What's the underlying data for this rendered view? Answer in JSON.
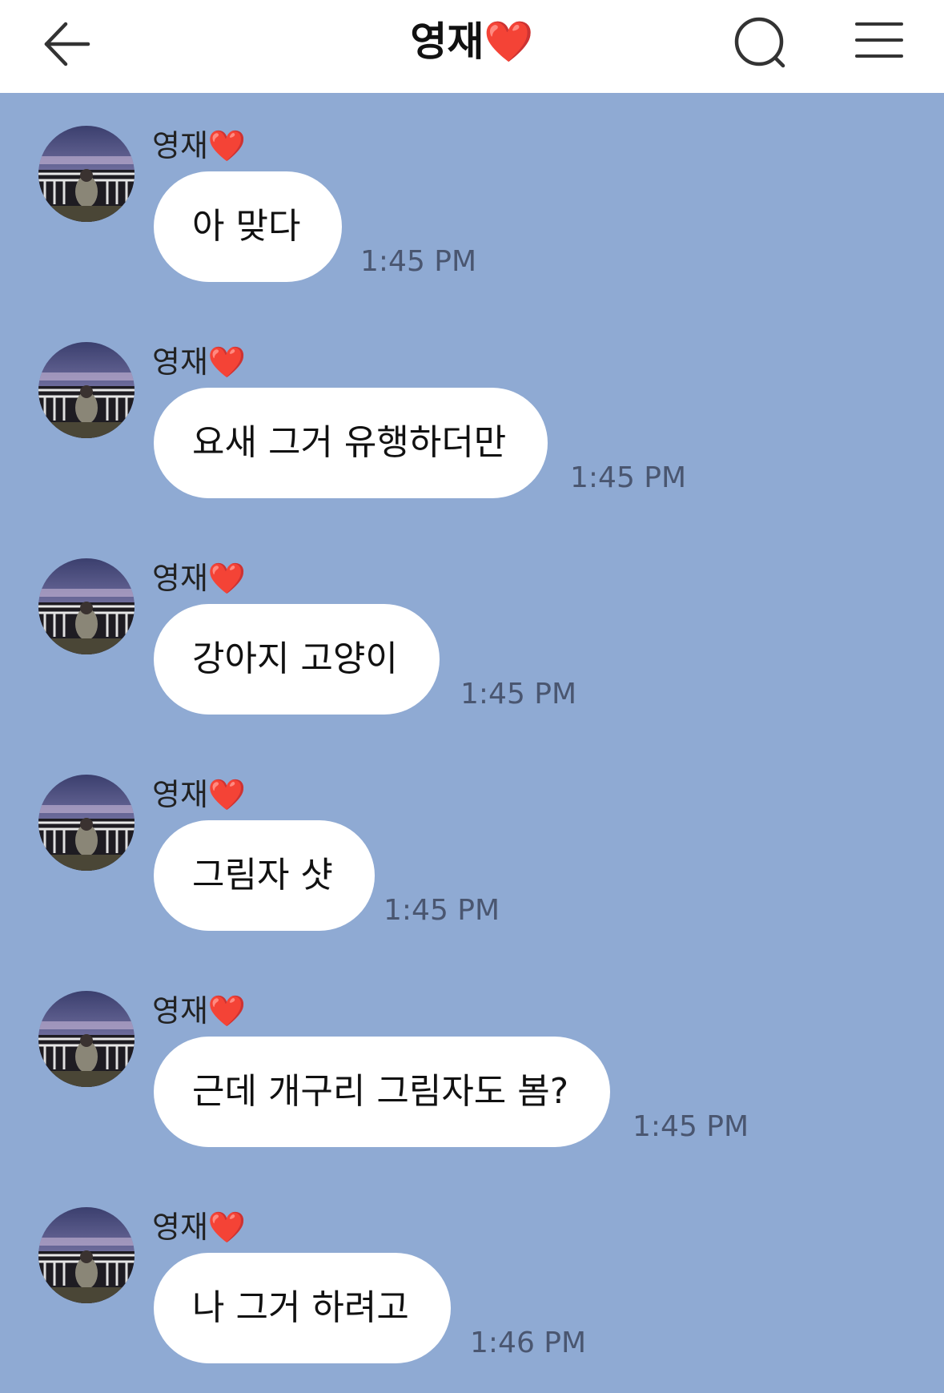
{
  "header": {
    "title": "영재❤️",
    "back_icon": "arrow-left-icon",
    "search_icon": "search-icon",
    "menu_icon": "hamburger-menu-icon"
  },
  "colors": {
    "header_bg": "#ffffff",
    "chat_bg": "#8faad3",
    "bubble_bg": "#ffffff",
    "time_text": "#4a5670"
  },
  "messages": [
    {
      "sender": "영재❤️",
      "text": "아 맞다",
      "time": "1:45 PM"
    },
    {
      "sender": "영재❤️",
      "text": "요새 그거 유행하더만",
      "time": "1:45 PM"
    },
    {
      "sender": "영재❤️",
      "text": "강아지 고양이",
      "time": "1:45 PM"
    },
    {
      "sender": "영재❤️",
      "text": "그림자 샷",
      "time": "1:45 PM"
    },
    {
      "sender": "영재❤️",
      "text": "근데 개구리 그림자도 봄?",
      "time": "1:45 PM"
    },
    {
      "sender": "영재❤️",
      "text": "나 그거 하려고",
      "time": "1:46 PM"
    }
  ]
}
